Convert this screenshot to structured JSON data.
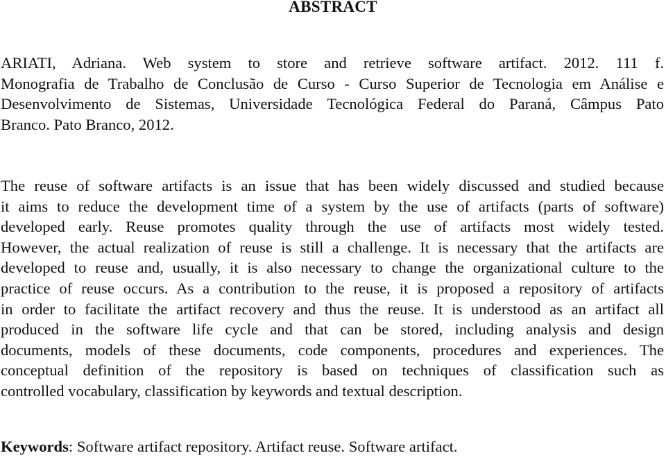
{
  "document": {
    "title": "ABSTRACT",
    "reference_lines": [
      "ARIATI, Adriana. Web system to store and retrieve software artifact. 2012. 111 f.",
      "Monografia de Trabalho de Conclusão de Curso - Curso Superior de Tecnologia em Análise e",
      "Desenvolvimento de Sistemas, Universidade Tecnológica Federal do Paraná, Câmpus Pato",
      "Branco. Pato Branco, 2012."
    ],
    "abstract_lines": [
      "The reuse of software artifacts is an issue that has been widely discussed and studied because",
      "it aims to reduce the development time of a system by the use of artifacts (parts of software)",
      "developed early. Reuse promotes quality through the use of artifacts most widely tested.",
      "However, the actual realization of reuse is still a challenge. It is necessary that the artifacts are",
      "developed to reuse and, usually, it is also necessary to change the organizational culture to the",
      "practice of reuse occurs. As a contribution to the reuse, it is proposed a repository of artifacts",
      "in order to facilitate the artifact recovery and thus the reuse. It is understood as an artifact all",
      "produced in the software life cycle and that can be stored, including analysis and design",
      "documents, models of these documents, code components, procedures and experiences. The",
      "conceptual definition of the repository is based on techniques of classification such as",
      "controlled vocabulary, classification by keywords and textual description."
    ],
    "keywords": {
      "label": "Keywords",
      "separator": ": ",
      "value": "Software artifact repository. Artifact reuse. Software artifact."
    }
  }
}
